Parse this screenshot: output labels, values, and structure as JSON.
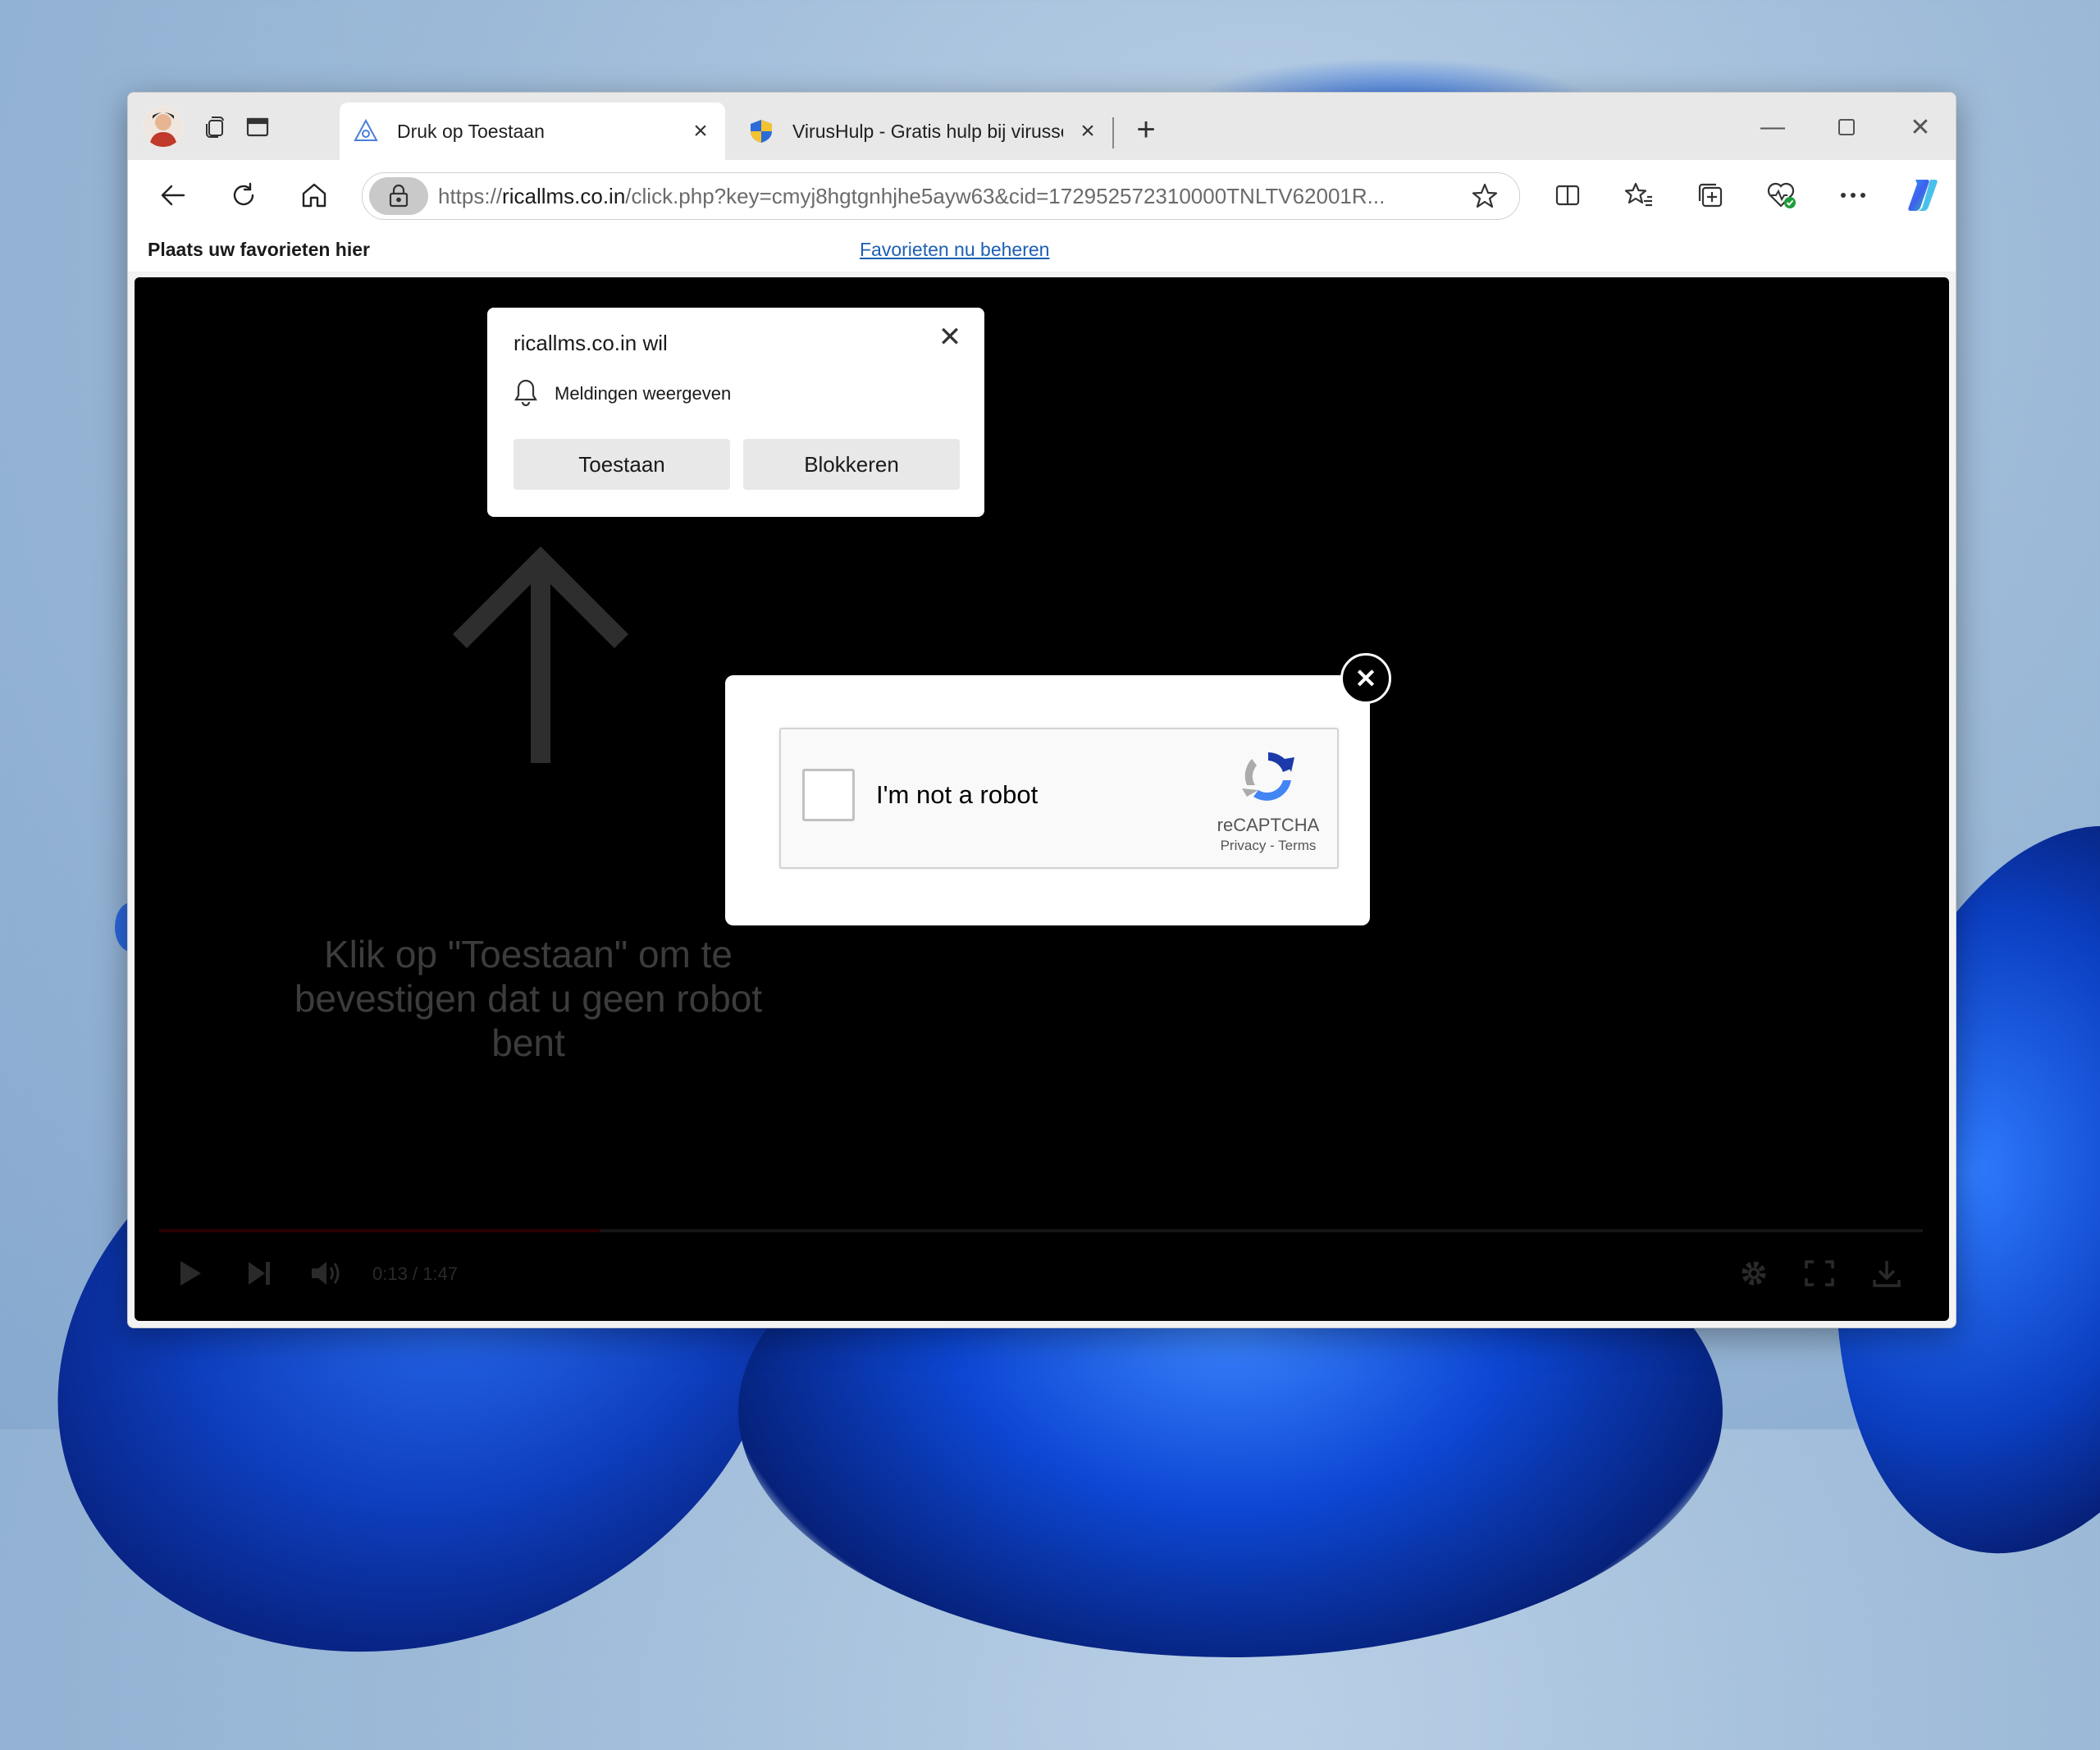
{
  "browser": {
    "tabs": [
      {
        "title": "Druk op Toestaan",
        "active": true
      },
      {
        "title": "VirusHulp - Gratis hulp bij virusse",
        "active": false
      }
    ],
    "address": {
      "url_prefix": "https://",
      "url_host": "ricallms.co.in",
      "url_path": "/click.php?key=cmyj8hgtgnhjhe5ayw63&cid=172952572310000TNLTV62001R..."
    },
    "favorites_bar": {
      "hint": "Plaats uw favorieten hier",
      "manage_link": "Favorieten nu beheren"
    }
  },
  "permission_popup": {
    "title": "ricallms.co.in wil",
    "permission": "Meldingen weergeven",
    "allow_label": "Toestaan",
    "block_label": "Blokkeren"
  },
  "page": {
    "background_text": "Klik op \"Toestaan\" om te bevestigen dat u geen robot bent",
    "video_time": "0:13 / 1:47",
    "progress_fraction": 0.25
  },
  "captcha": {
    "close_label": "✕",
    "checkbox_label": "I'm not a robot",
    "brand": "reCAPTCHA",
    "links": "Privacy - Terms"
  },
  "colors": {
    "link": "#1d5fb4",
    "page_background": "#000000",
    "desktop_accent": "#0e3fbf"
  }
}
